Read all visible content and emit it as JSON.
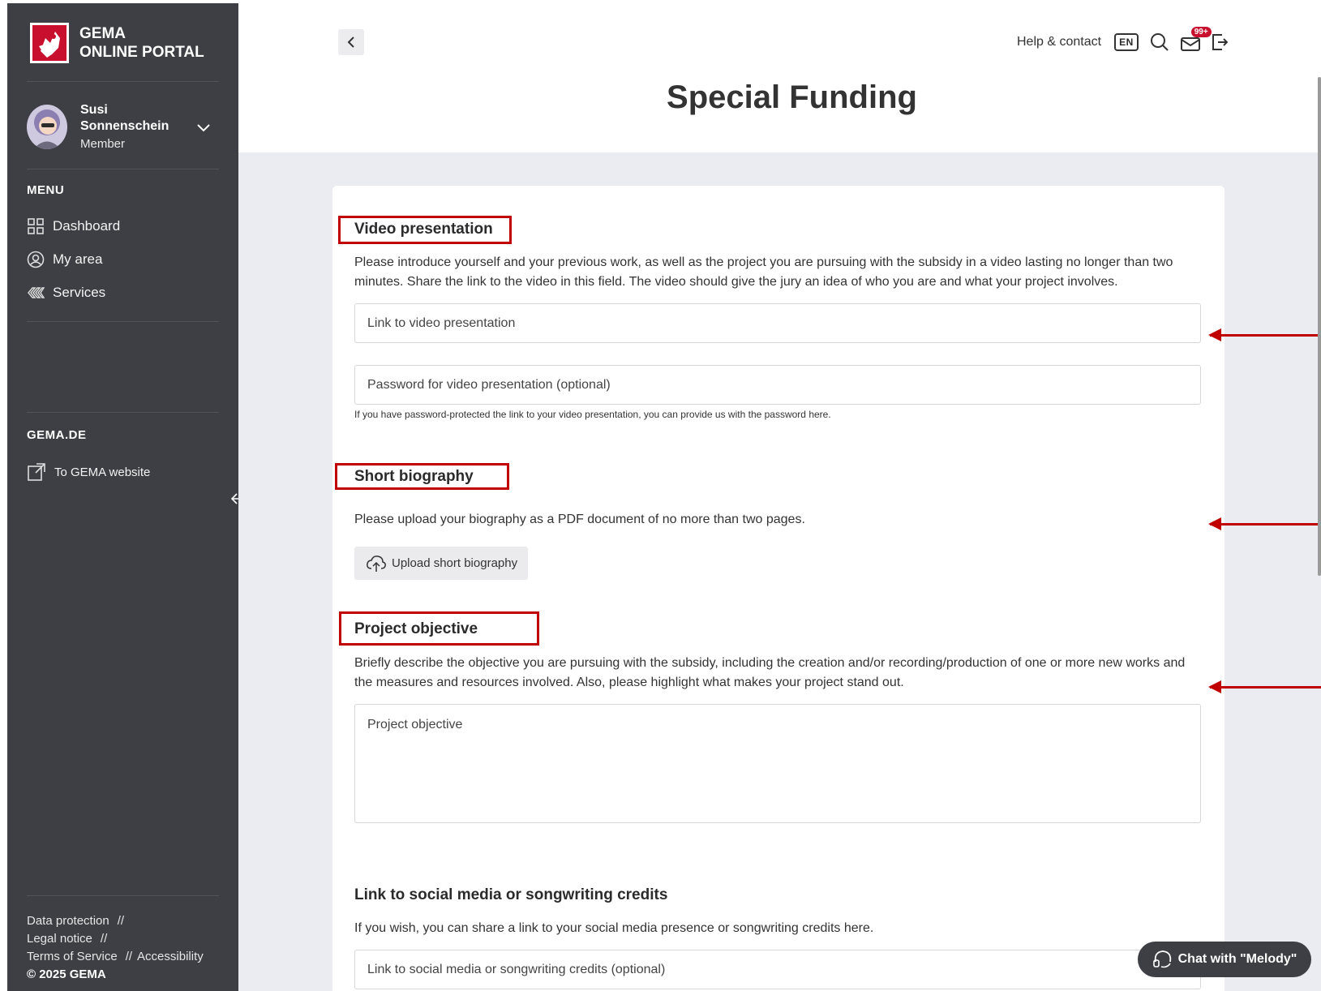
{
  "brand": {
    "line1": "GEMA",
    "line2": "ONLINE PORTAL"
  },
  "user": {
    "first_name": "Susi",
    "last_name": "Sonnenschein",
    "role": "Member"
  },
  "menu": {
    "heading": "MENU",
    "items": [
      {
        "label": "Dashboard",
        "icon": "grid-icon"
      },
      {
        "label": "My area",
        "icon": "user-circle-icon"
      },
      {
        "label": "Services",
        "icon": "services-icon"
      }
    ]
  },
  "gema_de": {
    "heading": "GEMA.DE",
    "website_link": "To GEMA website"
  },
  "footer": {
    "data_protection": "Data protection",
    "legal_notice": "Legal notice",
    "terms": "Terms of Service",
    "accessibility": "Accessibility",
    "separator": "//",
    "copyright": "© 2025 GEMA"
  },
  "header": {
    "help": "Help & contact",
    "language": "EN",
    "notifications": "99+"
  },
  "page": {
    "title": "Special Funding"
  },
  "sections": {
    "video": {
      "title": "Video presentation",
      "description": "Please introduce yourself and your previous work, as well as the project you are pursuing with the subsidy in a video lasting no longer than two minutes. Share the link to the video in this field. The video should give the jury an idea of who you are and what your project involves.",
      "link_placeholder": "Link to video presentation",
      "password_placeholder": "Password for video presentation (optional)",
      "password_hint": "If you have password-protected the link to your video presentation, you can provide us with the password here."
    },
    "biography": {
      "title": "Short biography",
      "description": "Please upload your biography as a PDF document of no more than two pages.",
      "upload_label": "Upload short biography"
    },
    "objective": {
      "title": "Project objective",
      "description": "Briefly describe the objective you are pursuing with the subsidy, including the creation and/or recording/production of one or more new works and the measures and resources involved. Also, please highlight what makes your project stand out.",
      "placeholder": "Project objective"
    },
    "social": {
      "title": "Link to social media or songwriting credits",
      "description": "If you wish, you can share a link to your social media presence or songwriting credits here.",
      "placeholder": "Link to social media or songwriting credits (optional)"
    }
  },
  "chat": {
    "label": "Chat with \"Melody\""
  },
  "colors": {
    "sidebar": "#3d3f44",
    "brand_red": "#c8102e",
    "annotation_red": "#c00000",
    "content_bg": "#ebebf2"
  }
}
